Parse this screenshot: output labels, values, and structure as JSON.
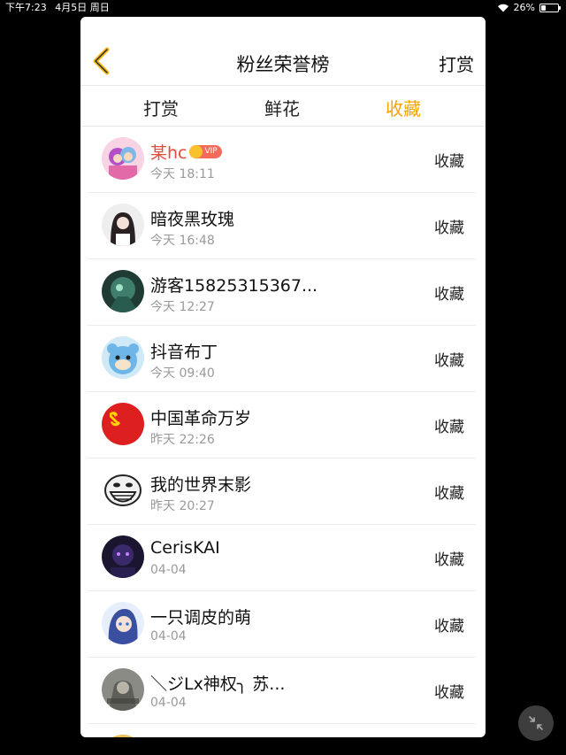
{
  "status_bar": {
    "time": "下午7:23",
    "date": "4月5日 周日",
    "battery": "26%",
    "battery_level": 0.26
  },
  "header": {
    "title": "粉丝荣誉榜",
    "right_link": "打赏",
    "back_icon": "chevron-left-icon",
    "accent_color": "#f5a400"
  },
  "tabs": [
    {
      "label": "打赏",
      "active": false
    },
    {
      "label": "鲜花",
      "active": false
    },
    {
      "label": "收藏",
      "active": true
    }
  ],
  "fans": [
    {
      "name": "某hc",
      "time": "今天 18:11",
      "action": "收藏",
      "vip": "VIP",
      "highlight": true
    },
    {
      "name": "暗夜黑玫瑰",
      "time": "今天 16:48",
      "action": "收藏"
    },
    {
      "name": "游客15825315367...",
      "time": "今天 12:27",
      "action": "收藏"
    },
    {
      "name": "抖音布丁",
      "time": "今天 09:40",
      "action": "收藏"
    },
    {
      "name": "中国革命万岁",
      "time": "昨天 22:26",
      "action": "收藏"
    },
    {
      "name": "我的世界末影",
      "time": "昨天 20:27",
      "action": "收藏"
    },
    {
      "name": "CerisKAI",
      "time": "04-04",
      "action": "收藏"
    },
    {
      "name": "一只调皮的萌",
      "time": "04-04",
      "action": "收藏"
    },
    {
      "name": "＼ジLx神权╮ 苏...",
      "time": "04-04",
      "action": "收藏"
    }
  ],
  "floating_button_icon": "collapse-icon"
}
